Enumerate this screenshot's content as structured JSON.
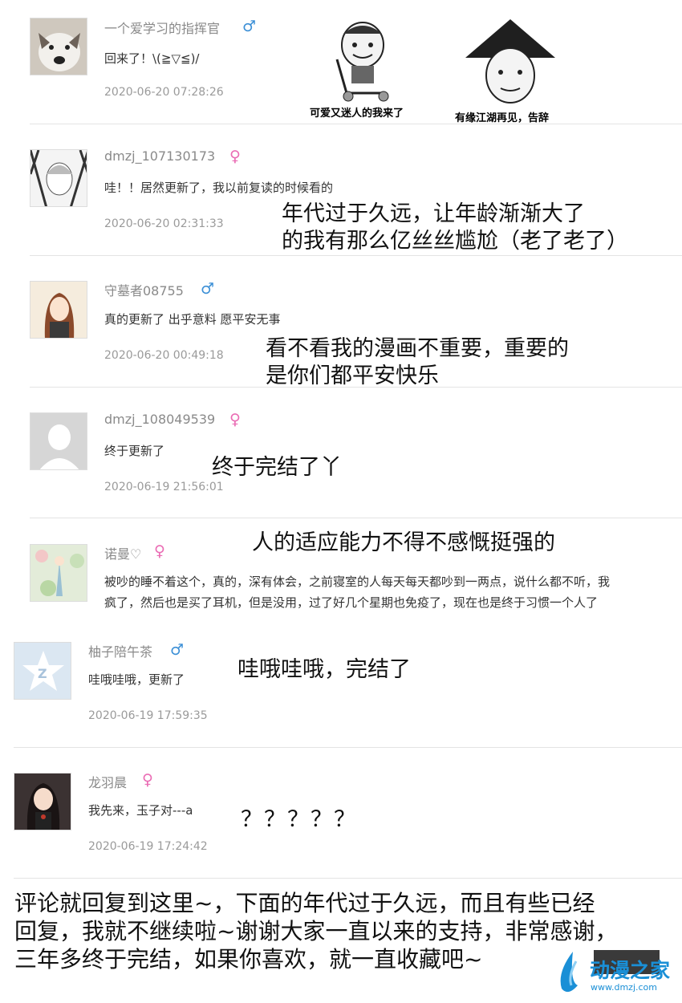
{
  "comments": [
    {
      "username": "一个爱学习的指挥官",
      "gender": "♂",
      "text": "回来了！\\(≧▽≦)/",
      "time": "2020-06-20 07:28:26"
    },
    {
      "username": "dmzj_107130173",
      "gender": "♀",
      "text": "哇！！居然更新了，我以前复读的时候看的",
      "time": "2020-06-20 02:31:33"
    },
    {
      "username": "守墓者08755",
      "gender": "♂",
      "text": "真的更新了 出乎意料 愿平安无事",
      "time": "2020-06-20 00:49:18"
    },
    {
      "username": "dmzj_108049539",
      "gender": "♀",
      "text": "终于更新了",
      "time": "2020-06-19 21:56:01"
    },
    {
      "username": "诺曼♡",
      "gender": "♀",
      "text_line1": "被吵的睡不着这个，真的，深有体会，之前寝室的人每天每天都吵到一两点，说什么都不听，我",
      "text_line2": "疯了，然后也是买了耳机，但是没用，过了好几个星期也免疫了，现在也是终于习惯一个人了"
    },
    {
      "username": "柚子陪午茶",
      "gender": "♂",
      "text": "哇哦哇哦，更新了",
      "time": "2020-06-19 17:59:35"
    },
    {
      "username": "龙羽晨",
      "gender": "♀",
      "text": "我先来，玉子对---a",
      "time": "2020-06-19 17:24:42"
    }
  ],
  "stickers": [
    {
      "caption": "可爱又迷人的我来了"
    },
    {
      "caption": "有缘江湖再见，告辞"
    }
  ],
  "author_notes": {
    "n1_line1": "年代过于久远，让年龄渐渐大了",
    "n1_line2": "的我有那么亿丝丝尴尬（老了老了）",
    "n2_line1": "看不看我的漫画不重要，重要的",
    "n2_line2": "是你们都平安快乐",
    "n3": "终于完结了丫",
    "n4": "人的适应能力不得不感慨挺强的",
    "n5": "哇哦哇哦，完结了",
    "n6": "？？？？？"
  },
  "footer": {
    "line1": "评论就回复到这里~，下面的年代过于久远，而且有些已经",
    "line2": "回复，我就不继续啦~谢谢大家一直以来的支持，非常感谢，",
    "line3": "三年多终于完结，如果你喜欢，就一直收藏吧~"
  },
  "logo": {
    "name": "动漫之家",
    "url": "www.dmzj.com"
  },
  "colors": {
    "male": "#3b8fd6",
    "female": "#ea6cb4",
    "brand": "#1a8fd6"
  }
}
